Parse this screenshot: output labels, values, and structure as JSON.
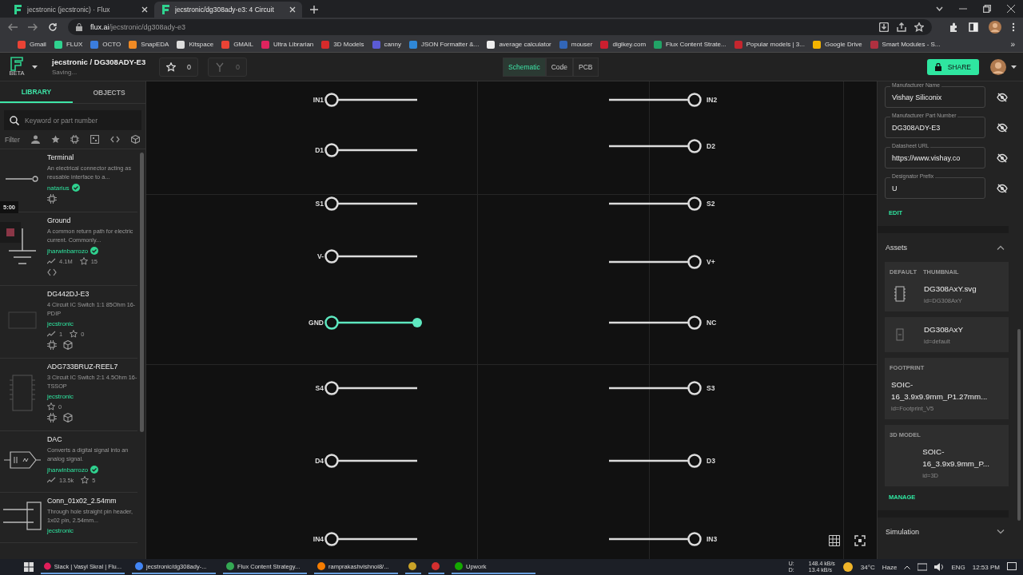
{
  "browser": {
    "tabs": [
      {
        "title": "jecstronic (jecstronic) · Flux",
        "selected": false
      },
      {
        "title": "jecstronic/dg308ady-e3: 4 Circuit",
        "selected": true
      }
    ],
    "url": {
      "host": "flux.ai",
      "path": "/jecstronic/dg308ady-e3"
    },
    "bookmarks": [
      {
        "label": "Gmail",
        "color": "#ea4335"
      },
      {
        "label": "FLUX",
        "color": "#2fd28f"
      },
      {
        "label": "OCTO",
        "color": "#3b7ddd"
      },
      {
        "label": "SnapEDA",
        "color": "#f08a24"
      },
      {
        "label": "Kitspace",
        "color": "#dddddd"
      },
      {
        "label": "GMAIL",
        "color": "#ea4335"
      },
      {
        "label": "Ultra Librarian",
        "color": "#e0245e"
      },
      {
        "label": "3D Models",
        "color": "#d62b2b"
      },
      {
        "label": "canny",
        "color": "#5b5bd6"
      },
      {
        "label": "JSON Formatter &...",
        "color": "#2f88d8"
      },
      {
        "label": "average calculator",
        "color": "#eeeeee"
      },
      {
        "label": "mouser",
        "color": "#3266b8"
      },
      {
        "label": "digikey.com",
        "color": "#cc1f2f"
      },
      {
        "label": "Flux Content Strate...",
        "color": "#21a366"
      },
      {
        "label": "Popular models | 3...",
        "color": "#c4262e"
      },
      {
        "label": "Google Drive",
        "color": "#f4b400"
      },
      {
        "label": "Smart Modules - S...",
        "color": "#b03040"
      }
    ],
    "more_bookmarks": "»"
  },
  "app": {
    "project": "jecstronic / DG308ADY-E3",
    "status": "Saving...",
    "logo_badge": "BETA",
    "star_count": "0",
    "fork_count": "0",
    "modes": [
      {
        "label": "Schematic",
        "selected": true
      },
      {
        "label": "Code",
        "selected": false
      },
      {
        "label": "PCB",
        "selected": false
      }
    ],
    "share": "SHARE"
  },
  "sidebar": {
    "tabs": [
      {
        "label": "LIBRARY",
        "selected": true
      },
      {
        "label": "OBJECTS",
        "selected": false
      }
    ],
    "search": {
      "placeholder": "Keyword or part number"
    },
    "filter_label": "Filter",
    "timer": "5:00",
    "items": [
      {
        "kind": "terminal",
        "title": "Terminal",
        "description": "An electrical connector acting as reusable interface to a...",
        "author": "natarius",
        "verified": true,
        "assets": [
          {
            "kind": "chip"
          }
        ]
      },
      {
        "kind": "ground",
        "title": "Ground",
        "description": "A common return path for electric current. Commonly...",
        "author": "jharwinbarrozo",
        "verified": true,
        "uses": "4.1M",
        "stars": "15",
        "assets": [
          {
            "kind": "code"
          }
        ]
      },
      {
        "kind": "dip",
        "title": "DG442DJ-E3",
        "description": "4 Circuit IC Switch 1:1 85Ohm 16-PDIP",
        "author": "jecstronic",
        "verified": false,
        "uses": "1",
        "stars": "0",
        "assets": [
          {
            "kind": "chip"
          },
          {
            "kind": "cube"
          }
        ]
      },
      {
        "kind": "tssop",
        "title": "ADG733BRUZ-REEL7",
        "description": "3 Circuit IC Switch 2:1 4.5Ohm 16-TSSOP",
        "author": "jecstronic",
        "verified": false,
        "stars": "0",
        "assets": [
          {
            "kind": "chip"
          },
          {
            "kind": "cube"
          }
        ]
      },
      {
        "kind": "dac",
        "title": "DAC",
        "description": "Converts a digital signal into an analog signal.",
        "author": "jharwinbarrozo",
        "verified": true,
        "uses": "13.5k",
        "stars": "5"
      },
      {
        "kind": "header",
        "title": "Conn_01x02_2.54mm",
        "description": "Through hole straight pin header, 1x02 pin, 2.54mm...",
        "author": "jecstronic",
        "verified": false
      }
    ]
  },
  "schematic": {
    "left_pins": [
      {
        "label": "IN1",
        "selected": false
      },
      {
        "label": "D1",
        "selected": false
      },
      {
        "label": "S1",
        "selected": false
      },
      {
        "label": "V-",
        "selected": false
      },
      {
        "label": "GND",
        "selected": true
      },
      {
        "label": "S4",
        "selected": false
      },
      {
        "label": "D4",
        "selected": false
      },
      {
        "label": "IN4",
        "selected": false
      }
    ],
    "right_pins": [
      {
        "label": "IN2",
        "selected": false
      },
      {
        "label": "D2",
        "selected": false
      },
      {
        "label": "S2",
        "selected": false
      },
      {
        "label": "V+",
        "selected": false
      },
      {
        "label": "NC",
        "selected": false
      },
      {
        "label": "S3",
        "selected": false
      },
      {
        "label": "D3",
        "selected": false
      },
      {
        "label": "IN3",
        "selected": false
      }
    ]
  },
  "properties": {
    "fields": [
      {
        "label": "Manufacturer Name",
        "value": "Vishay Siliconix"
      },
      {
        "label": "Manufacturer Part Number",
        "value": "DG308ADY-E3"
      },
      {
        "label": "Datasheet URL",
        "value": "https://www.vishay.co"
      },
      {
        "label": "Designator Prefix",
        "value": "U"
      }
    ],
    "edit": "EDIT",
    "assets": {
      "title": "Assets",
      "expanded": true,
      "cards": [
        {
          "kind": "symbol",
          "tags": [
            "DEFAULT",
            "THUMBNAIL"
          ],
          "name": "DG308AxY.svg",
          "id": "id=DG308AxY"
        },
        {
          "kind": "symbol-small",
          "name": "DG308AxY",
          "id": "id=default"
        },
        {
          "kind": "footprint",
          "tags": [
            "FOOTPRINT"
          ],
          "name": "SOIC-16_3.9x9.9mm_P1.27mm...",
          "id": "id=Footprint_V5"
        },
        {
          "kind": "model",
          "tags": [
            "3D MODEL"
          ],
          "name": "SOIC-16_3.9x9.9mm_P...",
          "id": "id=3D"
        }
      ],
      "manage": "MANAGE"
    },
    "simulation": {
      "title": "Simulation",
      "expanded": false
    }
  },
  "taskbar": {
    "items": [
      {
        "label": "Slack | Vasyl Skral | Flu...",
        "color": "#e01e5a"
      },
      {
        "label": "jecstronic/dg308ady-...",
        "color": "#4285f4"
      },
      {
        "label": "Flux Content Strategy...",
        "color": "#34a853"
      },
      {
        "label": "ramprakashvishnoi8/...",
        "color": "#f57c00"
      },
      {
        "color": "#c9a227"
      },
      {
        "color": "#d32f2f"
      },
      {
        "label": "Upwork",
        "color": "#14a800"
      }
    ],
    "upload": "U:",
    "upload_rate": "148.4 kB/s",
    "download": "D:",
    "download_rate": "13.4 kB/s",
    "temperature": "34°C",
    "weather": "Haze",
    "language": "ENG",
    "time": "12:53 PM"
  }
}
